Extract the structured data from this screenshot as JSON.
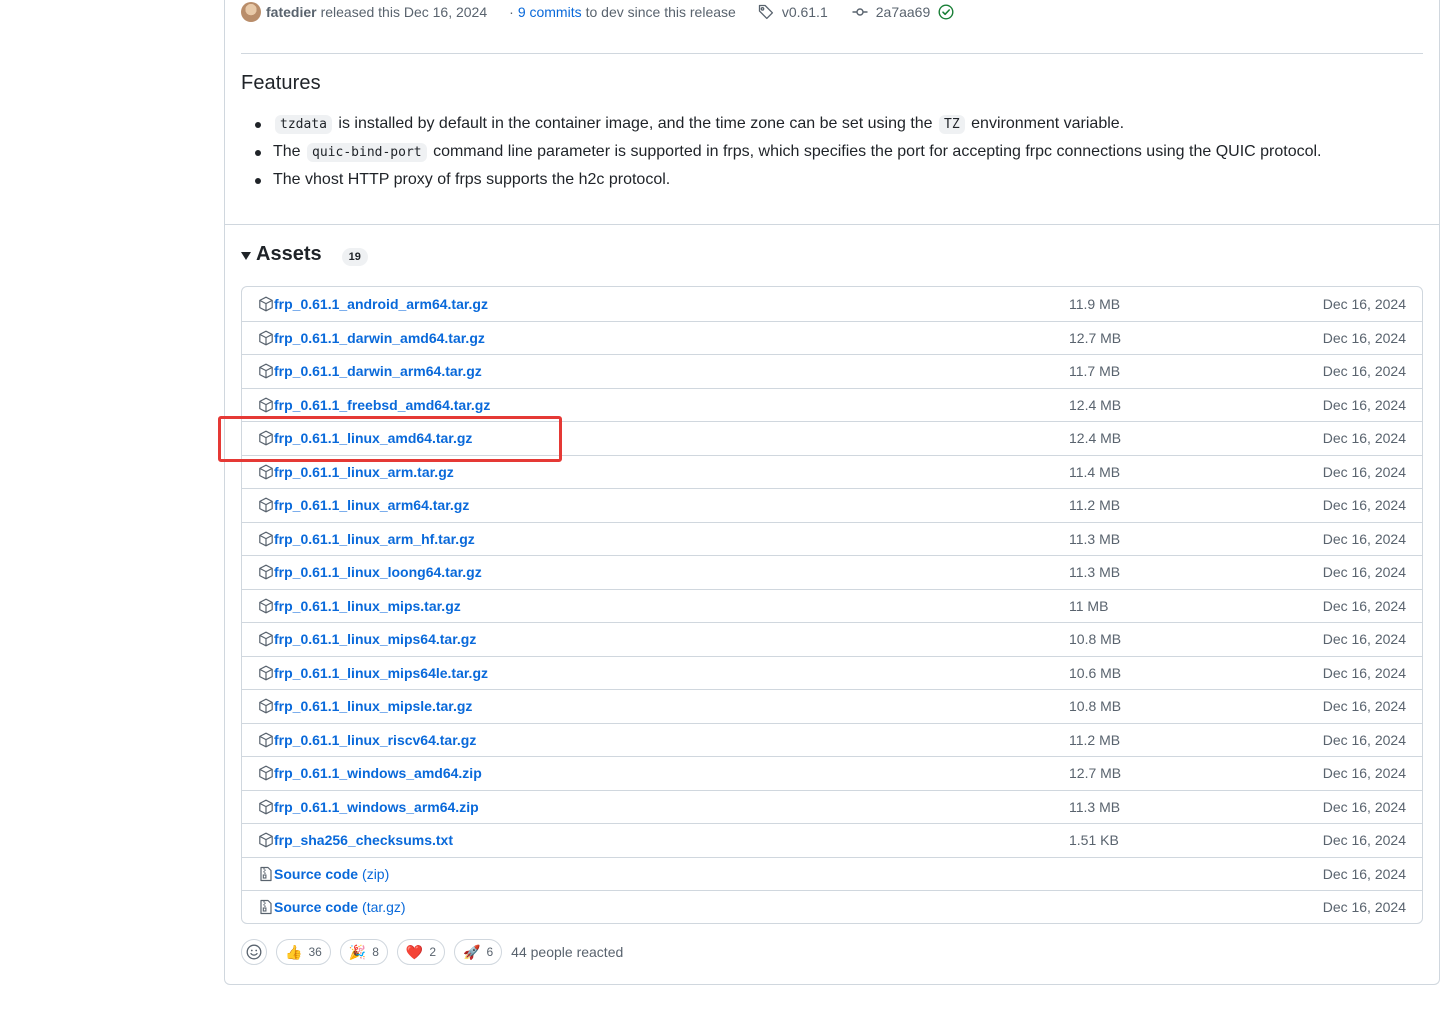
{
  "release_meta": {
    "author": "fatedier",
    "released_text": "released this Dec 16, 2024",
    "commits_separator": "·",
    "commits_link": "9 commits",
    "commits_tail": "to dev since this release",
    "tag": "v0.61.1",
    "commit_hash": "2a7aa69"
  },
  "features": {
    "title": "Features",
    "items": [
      {
        "code1": "tzdata",
        "text1": "is installed by default in the container image, and the time zone can be set using the",
        "code2": "TZ",
        "text2": "environment variable."
      },
      {
        "prefix": "The",
        "code1": "quic-bind-port",
        "text1": "command line parameter is supported in frps, which specifies the port for accepting frpc connections using the QUIC protocol."
      },
      {
        "text1": "The vhost HTTP proxy of frps supports the h2c protocol."
      }
    ]
  },
  "assets": {
    "title": "Assets",
    "count": "19",
    "rows": [
      {
        "name": "frp_0.61.1_android_arm64.tar.gz",
        "size": "11.9 MB",
        "date": "Dec 16, 2024"
      },
      {
        "name": "frp_0.61.1_darwin_amd64.tar.gz",
        "size": "12.7 MB",
        "date": "Dec 16, 2024"
      },
      {
        "name": "frp_0.61.1_darwin_arm64.tar.gz",
        "size": "11.7 MB",
        "date": "Dec 16, 2024"
      },
      {
        "name": "frp_0.61.1_freebsd_amd64.tar.gz",
        "size": "12.4 MB",
        "date": "Dec 16, 2024"
      },
      {
        "name": "frp_0.61.1_linux_amd64.tar.gz",
        "size": "12.4 MB",
        "date": "Dec 16, 2024"
      },
      {
        "name": "frp_0.61.1_linux_arm.tar.gz",
        "size": "11.4 MB",
        "date": "Dec 16, 2024"
      },
      {
        "name": "frp_0.61.1_linux_arm64.tar.gz",
        "size": "11.2 MB",
        "date": "Dec 16, 2024"
      },
      {
        "name": "frp_0.61.1_linux_arm_hf.tar.gz",
        "size": "11.3 MB",
        "date": "Dec 16, 2024"
      },
      {
        "name": "frp_0.61.1_linux_loong64.tar.gz",
        "size": "11.3 MB",
        "date": "Dec 16, 2024"
      },
      {
        "name": "frp_0.61.1_linux_mips.tar.gz",
        "size": "11 MB",
        "date": "Dec 16, 2024"
      },
      {
        "name": "frp_0.61.1_linux_mips64.tar.gz",
        "size": "10.8 MB",
        "date": "Dec 16, 2024"
      },
      {
        "name": "frp_0.61.1_linux_mips64le.tar.gz",
        "size": "10.6 MB",
        "date": "Dec 16, 2024"
      },
      {
        "name": "frp_0.61.1_linux_mipsle.tar.gz",
        "size": "10.8 MB",
        "date": "Dec 16, 2024"
      },
      {
        "name": "frp_0.61.1_linux_riscv64.tar.gz",
        "size": "11.2 MB",
        "date": "Dec 16, 2024"
      },
      {
        "name": "frp_0.61.1_windows_amd64.zip",
        "size": "12.7 MB",
        "date": "Dec 16, 2024"
      },
      {
        "name": "frp_0.61.1_windows_arm64.zip",
        "size": "11.3 MB",
        "date": "Dec 16, 2024"
      },
      {
        "name": "frp_sha256_checksums.txt",
        "size": "1.51 KB",
        "date": "Dec 16, 2024"
      }
    ],
    "source_rows": [
      {
        "name": "Source code",
        "format": "(zip)",
        "date": "Dec 16, 2024"
      },
      {
        "name": "Source code",
        "format": "(tar.gz)",
        "date": "Dec 16, 2024"
      }
    ]
  },
  "reactions": {
    "items": [
      {
        "emoji": "👍",
        "icon": "thumbs-up-icon",
        "count": "36"
      },
      {
        "emoji": "🎉",
        "icon": "party-popper-icon",
        "count": "8"
      },
      {
        "emoji": "❤️",
        "icon": "heart-icon",
        "count": "2"
      },
      {
        "emoji": "🚀",
        "icon": "rocket-icon",
        "count": "6"
      }
    ],
    "summary": "44 people reacted"
  },
  "colors": {
    "link": "#0969da",
    "muted": "#59636e",
    "border": "#d0d7de",
    "success": "#1a7f37",
    "highlight": "#e53935"
  }
}
